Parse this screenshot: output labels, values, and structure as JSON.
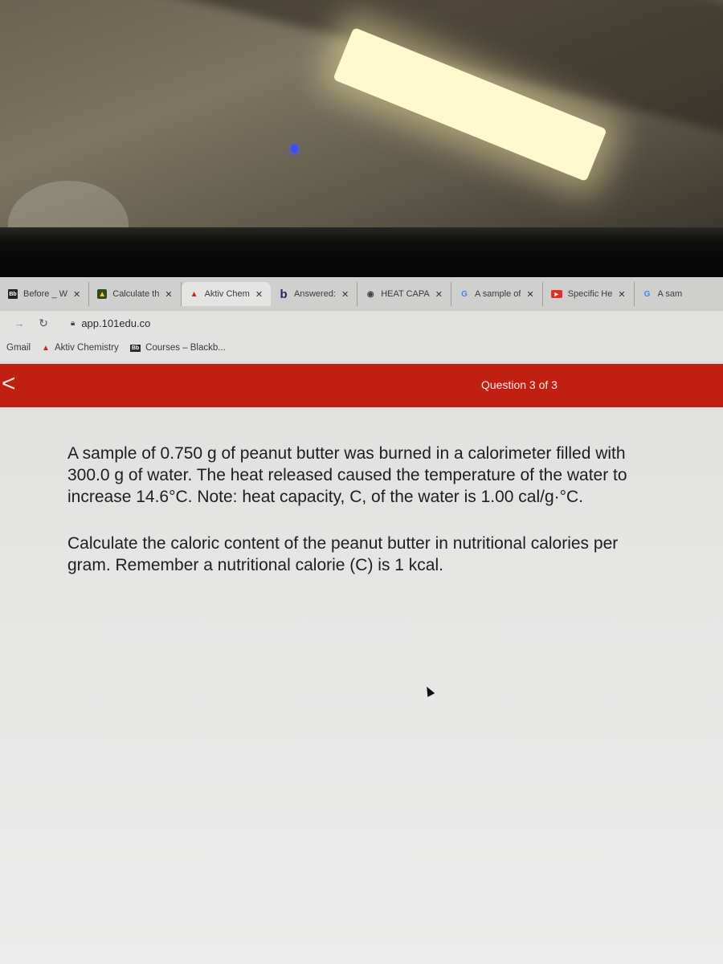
{
  "browser": {
    "tabs": [
      {
        "icon": "blackboard-icon",
        "title": "Before _ W",
        "active": false
      },
      {
        "icon": "calculate-site-icon",
        "title": "Calculate th",
        "active": false
      },
      {
        "icon": "aktiv-icon",
        "title": "Aktiv Chem",
        "active": true
      },
      {
        "icon": "bartleby-icon",
        "title": "Answered: ",
        "active": false
      },
      {
        "icon": "globe-icon",
        "title": "HEAT CAPA",
        "active": false
      },
      {
        "icon": "google-icon",
        "title": "A sample of",
        "active": false
      },
      {
        "icon": "youtube-icon",
        "title": "Specific He",
        "active": false
      },
      {
        "icon": "google-icon",
        "title": "A sam",
        "active": false
      }
    ],
    "tab_close_glyph": "✕",
    "address_bar": {
      "url": "app.101edu.co"
    },
    "bookmarks": [
      {
        "icon": "gmail-icon",
        "label": "Gmail"
      },
      {
        "icon": "aktiv-icon",
        "label": "Aktiv Chemistry"
      },
      {
        "icon": "blackboard-icon",
        "label": "Courses – Blackb..."
      }
    ]
  },
  "page": {
    "header": {
      "back_glyph": "<",
      "question_counter": "Question 3 of 3"
    },
    "question": {
      "paragraph_1": "A sample of 0.750 g of peanut butter was burned in a calorimeter filled with 300.0 g of water. The heat released caused the temperature of the water to increase 14.6°C. Note: heat capacity, C, of the water is 1.00 cal/g·°C.",
      "paragraph_2": "Calculate the caloric content of the peanut butter in nutritional calories per gram. Remember a nutritional calorie (C) is 1 kcal."
    }
  },
  "colors": {
    "header_red": "#c11f12",
    "page_background": "#e6e7e5"
  }
}
